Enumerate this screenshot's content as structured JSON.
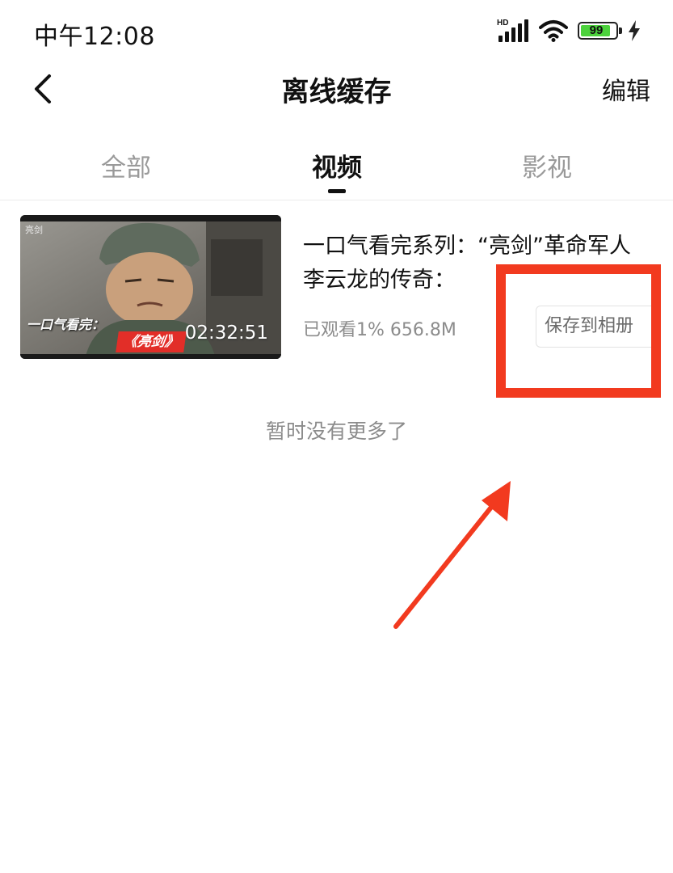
{
  "status_bar": {
    "time": "中午12:08",
    "network": "HD",
    "battery": "99",
    "icons": [
      "signal-icon",
      "wifi-icon",
      "battery-icon",
      "charging-bolt-icon"
    ]
  },
  "header": {
    "title": "离线缓存",
    "edit_label": "编辑",
    "back_icon": "chevron-left-icon"
  },
  "tabs": [
    {
      "label": "全部",
      "active": false
    },
    {
      "label": "视频",
      "active": true
    },
    {
      "label": "影视",
      "active": false
    }
  ],
  "videos": [
    {
      "thumbnail": {
        "corner_text": "亮剑",
        "overlay_text": "一口气看完：",
        "badge_text": "《亮剑》",
        "duration": "02:32:51"
      },
      "title": "一口气看完系列：“亮剑”革命军人李云龙的传奇：",
      "meta": "已观看1%  656.8M",
      "save_button": "保存到相册"
    }
  ],
  "empty_note": "暂时没有更多了",
  "colors": {
    "annotation_red": "#f23a1f",
    "battery_green": "#4cd23c",
    "muted_text": "#8c8c8c"
  }
}
